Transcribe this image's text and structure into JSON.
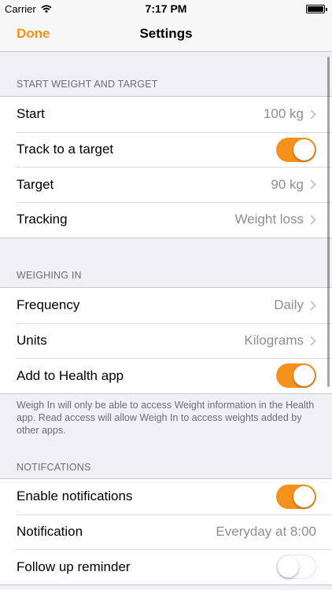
{
  "status_bar": {
    "carrier": "Carrier",
    "time": "7:17 PM"
  },
  "nav": {
    "done_label": "Done",
    "title": "Settings"
  },
  "sections": {
    "start_weight": {
      "header": "START WEIGHT AND TARGET",
      "start": {
        "label": "Start",
        "value": "100 kg"
      },
      "track_target": {
        "label": "Track to a target",
        "toggle": "on"
      },
      "target": {
        "label": "Target",
        "value": "90 kg"
      },
      "tracking": {
        "label": "Tracking",
        "value": "Weight loss"
      }
    },
    "weighing_in": {
      "header": "WEIGHING IN",
      "frequency": {
        "label": "Frequency",
        "value": "Daily"
      },
      "units": {
        "label": "Units",
        "value": "Kilograms"
      },
      "health": {
        "label": "Add to Health app",
        "toggle": "on"
      },
      "footer": "Weigh In will only be able to access Weight information in the Health app. Read access will allow Weigh In to access weights added by other apps."
    },
    "notifications": {
      "header": "NOTIFCATIONS",
      "enable": {
        "label": "Enable notifications",
        "toggle": "on"
      },
      "notification": {
        "label": "Notification",
        "value": "Everyday at 8:00"
      },
      "follow_up": {
        "label": "Follow up reminder",
        "toggle": "off"
      }
    }
  },
  "colors": {
    "accent": "#f5921e",
    "background": "#efeff4",
    "secondary_text": "#8e8e93"
  },
  "icons": {
    "wifi": "wifi-icon",
    "battery": "battery-icon",
    "chevron": "chevron-right-icon"
  }
}
